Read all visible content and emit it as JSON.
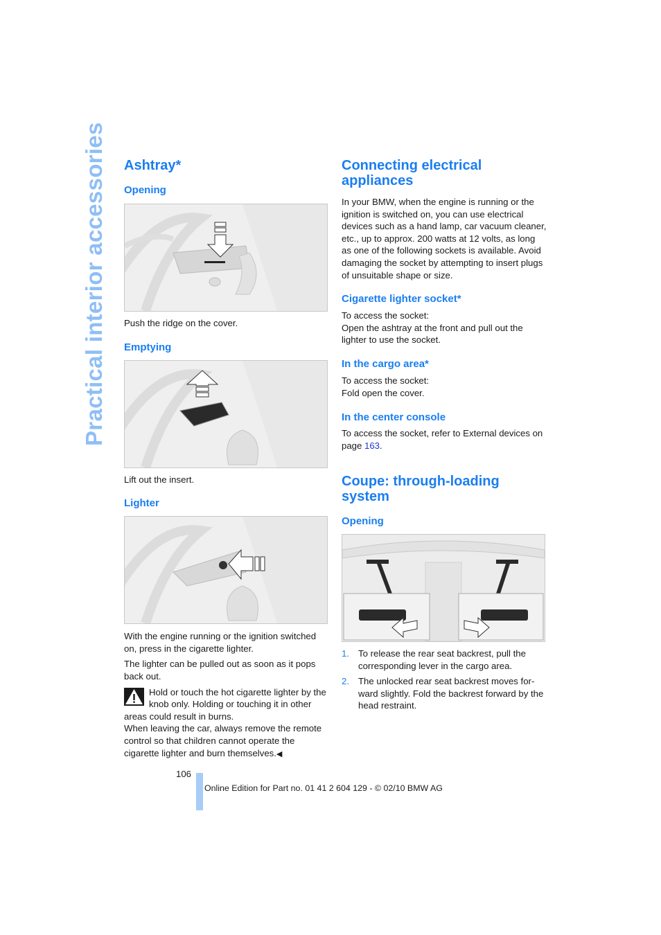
{
  "side_title": "Practical interior accessories",
  "left": {
    "title": "Ashtray*",
    "opening": {
      "heading": "Opening",
      "image_label": "ashtray-opening-illustration",
      "caption": "Push the ridge on the cover."
    },
    "emptying": {
      "heading": "Emptying",
      "image_label": "ashtray-emptying-illustration",
      "caption": "Lift out the insert."
    },
    "lighter": {
      "heading": "Lighter",
      "image_label": "cigarette-lighter-illustration",
      "para1": "With the engine running or the ignition switched on, press in the cigarette lighter.",
      "para2": "The lighter can be pulled out as soon as it pops back out.",
      "warning_icon": "warning-triangle-icon",
      "warning_text1": "Hold or touch the hot cigarette lighter by the knob only. Holding or touching it in other areas could result in burns.",
      "warning_text2": "When leaving the car, always remove the remote control so that children cannot operate the cigarette lighter and burn themselves.",
      "end_mark": "◀"
    }
  },
  "right": {
    "title": "Connecting electrical appliances",
    "intro": "In your BMW, when the engine is running or the ignition is switched on, you can use electrical devices such as a hand lamp, car vacuum cleaner, etc., up to approx. 200 watts at 12 volts, as long as one of the following sockets is available. Avoid damaging the socket by attempting to insert plugs of unsuitable shape or size.",
    "cig_socket": {
      "heading": "Cigarette lighter socket*",
      "line1": "To access the socket:",
      "line2": "Open the ashtray at the front and pull out the lighter to use the socket."
    },
    "cargo": {
      "heading": "In the cargo area*",
      "line1": "To access the socket:",
      "line2": "Fold open the cover."
    },
    "console": {
      "heading": "In the center console",
      "text_before": "To access the socket, refer to External devices on page ",
      "page_link": "163",
      "text_after": "."
    },
    "coupe": {
      "title": "Coupe: through-loading system",
      "heading": "Opening",
      "image_label": "through-loading-levers-illustration",
      "steps": [
        {
          "num": "1.",
          "text": "To release the rear seat backrest, pull the corresponding lever in the cargo area."
        },
        {
          "num": "2.",
          "text": "The unlocked rear seat backrest moves for-ward slightly. Fold the backrest forward by the head restraint."
        }
      ]
    }
  },
  "footer": {
    "page_number": "106",
    "edition": "Online Edition for Part no. 01 41 2 604 129 - © 02/10 BMW AG"
  },
  "colors": {
    "heading_blue": "#1a7ef0",
    "side_title_blue": "#8fbef5",
    "footer_bar": "#a8ccf7",
    "link": "#2038c8"
  }
}
